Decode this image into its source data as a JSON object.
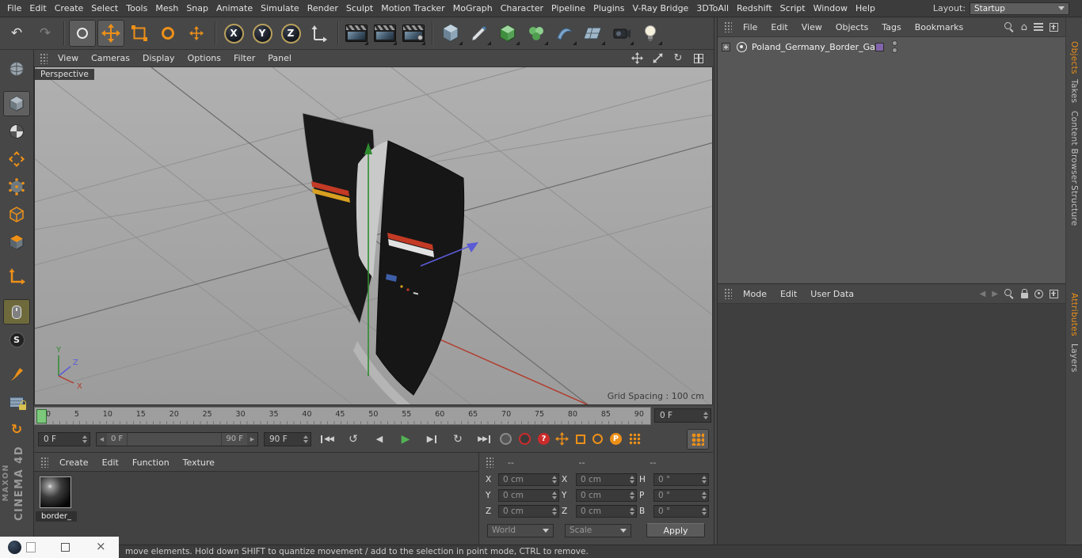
{
  "colors": {
    "accent_orange": "#ED9018",
    "play_green": "#53B253",
    "record_red": "#CC2B2B",
    "axis_x_red": "#B23C2E",
    "axis_y_green": "#2E8B2E",
    "axis_z_blue": "#5B5BD6",
    "layer_purple": "#8264AB",
    "viewport_gray": "#A6A6A6"
  },
  "icons": {
    "undo": "↶",
    "redo": "↷",
    "prev": "◀",
    "next": "▶",
    "play": "▶",
    "rewind": "◀◀",
    "forward": "▶▶",
    "loop_ccw": "↺",
    "loop_cw": "↻",
    "home": "⌂",
    "close": "×"
  },
  "menubar": {
    "items": [
      "File",
      "Edit",
      "Create",
      "Select",
      "Tools",
      "Mesh",
      "Snap",
      "Animate",
      "Simulate",
      "Render",
      "Sculpt",
      "Motion Tracker",
      "MoGraph",
      "Character",
      "Pipeline",
      "Plugins",
      "V-Ray Bridge",
      "3DToAll",
      "Redshift",
      "Script",
      "Window",
      "Help"
    ],
    "layout_label": "Layout:",
    "layout_value": "Startup"
  },
  "toolbar": {
    "axis_x": "X",
    "axis_y": "Y",
    "axis_z": "Z"
  },
  "left_toolbar": {
    "solo_letter": "S"
  },
  "viewport": {
    "menu": [
      "View",
      "Cameras",
      "Display",
      "Options",
      "Filter",
      "Panel"
    ],
    "camera_label": "Perspective",
    "grid_spacing": "Grid Spacing : 100 cm",
    "axis_labels": {
      "x": "X",
      "y": "Y",
      "z": "Z"
    }
  },
  "timeline": {
    "ticks": [
      "0",
      "5",
      "10",
      "15",
      "20",
      "25",
      "30",
      "35",
      "40",
      "45",
      "50",
      "55",
      "60",
      "65",
      "70",
      "75",
      "80",
      "85",
      "90"
    ],
    "ruler_frame": "0 F",
    "current_frame": "0 F",
    "range_start": "0 F",
    "range_end": "90 F",
    "end_frame": "90 F",
    "parameter_letter": "P",
    "help_label": "?"
  },
  "materials": {
    "menu": [
      "Create",
      "Edit",
      "Function",
      "Texture"
    ],
    "items": [
      {
        "name": "border_"
      }
    ]
  },
  "coordinates": {
    "headers": [
      "--",
      "--",
      "--"
    ],
    "position": {
      "label_x": "X",
      "x": "0 cm",
      "label_y": "Y",
      "y": "0 cm",
      "label_z": "Z",
      "z": "0 cm"
    },
    "size": {
      "label_x": "X",
      "x": "0 cm",
      "label_y": "Y",
      "y": "0 cm",
      "label_z": "Z",
      "z": "0 cm"
    },
    "rotation": {
      "label_h": "H",
      "h": "0 °",
      "label_p": "P",
      "p": "0 °",
      "label_b": "B",
      "b": "0 °"
    },
    "world": "World",
    "scale": "Scale",
    "apply": "Apply"
  },
  "object_manager": {
    "menu": [
      "File",
      "Edit",
      "View",
      "Objects",
      "Tags",
      "Bookmarks"
    ],
    "objects": [
      {
        "name": "Poland_Germany_Border_Gate"
      }
    ]
  },
  "attribute_manager": {
    "menu": [
      "Mode",
      "Edit",
      "User Data"
    ]
  },
  "right_tabs": {
    "top": [
      "Objects",
      "Takes",
      "Content Browser",
      "Structure"
    ],
    "bottom": [
      "Attributes",
      "Layers"
    ]
  },
  "status_bar": {
    "text": "move elements. Hold down SHIFT to quantize movement / add to the selection in point mode, CTRL to remove."
  },
  "branding": {
    "maxon": "MAXON",
    "cinema": "CINEMA 4D"
  }
}
